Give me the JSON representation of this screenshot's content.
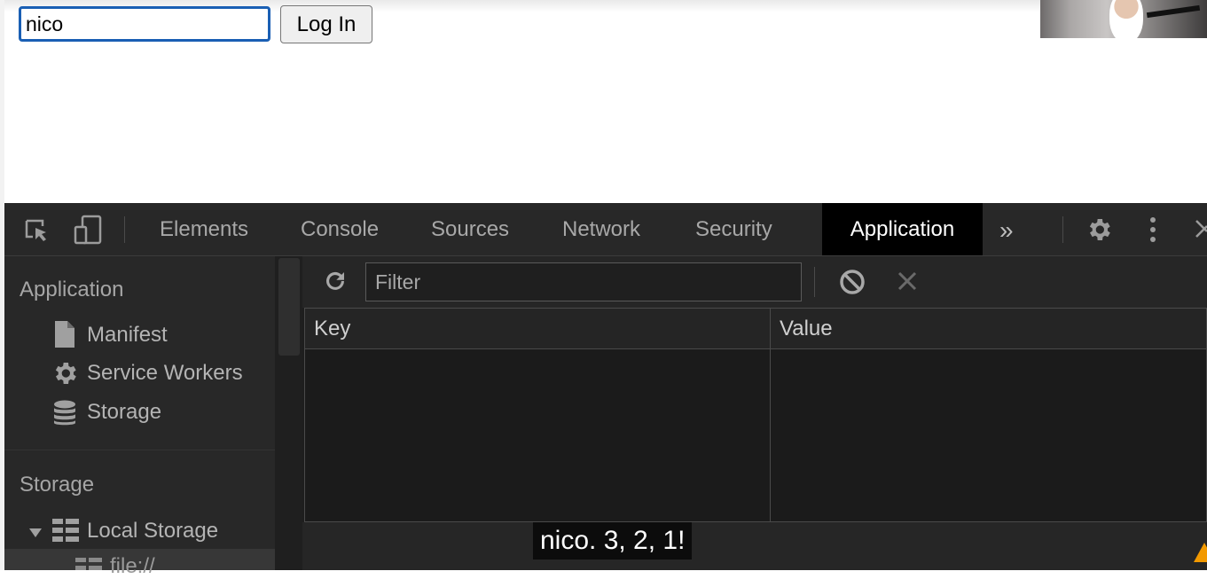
{
  "page": {
    "username_value": "nico",
    "login_button_label": "Log In"
  },
  "devtools": {
    "tabs": [
      "Elements",
      "Console",
      "Sources",
      "Network",
      "Security",
      "Application"
    ],
    "active_tab": "Application",
    "more_tabs_icon": "chevron-double-right-icon",
    "settings_icon": "gear-icon",
    "menu_icon": "kebab-menu-icon",
    "close_icon": "close-icon",
    "sidebar": {
      "application_header": "Application",
      "application_items": [
        {
          "label": "Manifest",
          "icon": "file-icon"
        },
        {
          "label": "Service Workers",
          "icon": "gear-icon"
        },
        {
          "label": "Storage",
          "icon": "database-icon"
        }
      ],
      "storage_header": "Storage",
      "local_storage_label": "Local Storage",
      "local_storage_child": "file://"
    },
    "toolbar": {
      "refresh_icon": "refresh-icon",
      "filter_placeholder": "Filter",
      "clear_all_icon": "block-icon",
      "delete_icon": "close-icon"
    },
    "table": {
      "columns": [
        "Key",
        "Value"
      ]
    },
    "colors": {
      "panel_bg": "#242424",
      "active_tab_bg": "#000000",
      "input_focus": "#1a5fb4"
    }
  },
  "caption": "nico. 3, 2, 1!"
}
